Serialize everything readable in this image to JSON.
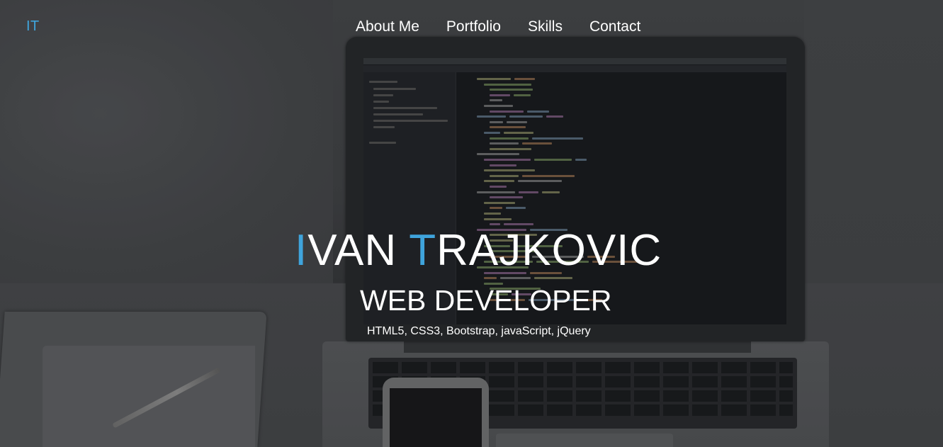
{
  "nav": {
    "brand": "IT",
    "items": [
      {
        "label": "About Me"
      },
      {
        "label": "Portfolio"
      },
      {
        "label": "Skills"
      },
      {
        "label": "Contact"
      }
    ]
  },
  "hero": {
    "name_first_initial": "I",
    "name_first_rest": "VAN ",
    "name_last_initial": "T",
    "name_last_rest": "RAJKOVIC",
    "role": "WEB DEVELOPER",
    "skills": "HTML5, CSS3, Bootstrap, javaScript, jQuery"
  },
  "colors": {
    "accent": "#3fa4dc",
    "text": "#ffffff"
  }
}
